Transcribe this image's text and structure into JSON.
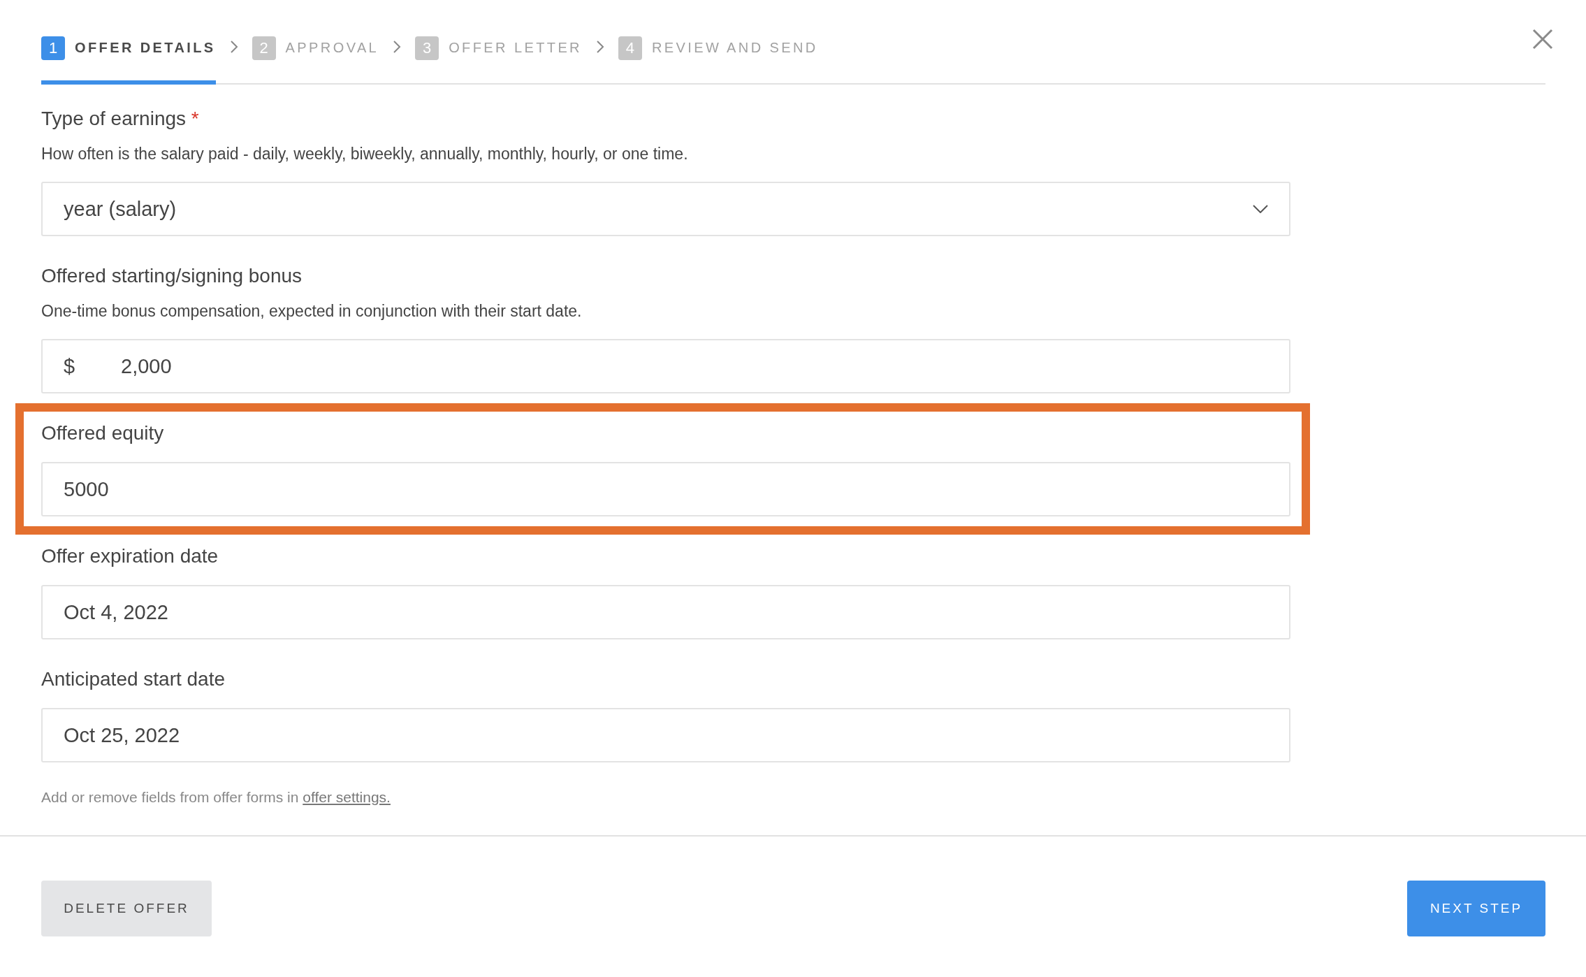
{
  "steps": [
    {
      "number": "1",
      "label": "OFFER DETAILS",
      "selected": true
    },
    {
      "number": "2",
      "label": "APPROVAL",
      "selected": false
    },
    {
      "number": "3",
      "label": "OFFER LETTER",
      "selected": false
    },
    {
      "number": "4",
      "label": "REVIEW AND SEND",
      "selected": false
    }
  ],
  "fields": [
    {
      "kind": "select",
      "label": "Type of earnings",
      "required_mark": "*",
      "description": "How often is the salary paid - daily, weekly, biweekly, annually, monthly, hourly, or one time.",
      "value": "year (salary)",
      "highlighted": false
    },
    {
      "kind": "currency",
      "label": "Offered starting/signing bonus",
      "description": "One-time bonus compensation, expected in conjunction with their start date.",
      "prefix": "$",
      "value": "2,000",
      "highlighted": false
    },
    {
      "kind": "text",
      "label": "Offered equity",
      "value": "5000",
      "highlighted": true
    },
    {
      "kind": "text",
      "label": "Offer expiration date",
      "value": "Oct 4, 2022",
      "highlighted": false
    },
    {
      "kind": "text",
      "label": "Anticipated start date",
      "value": "Oct 25, 2022",
      "highlighted": false
    }
  ],
  "note": {
    "text": "Add or remove fields from offer forms in ",
    "link": "offer settings."
  },
  "buttons": {
    "delete": "DELETE OFFER",
    "next": "NEXT STEP"
  }
}
